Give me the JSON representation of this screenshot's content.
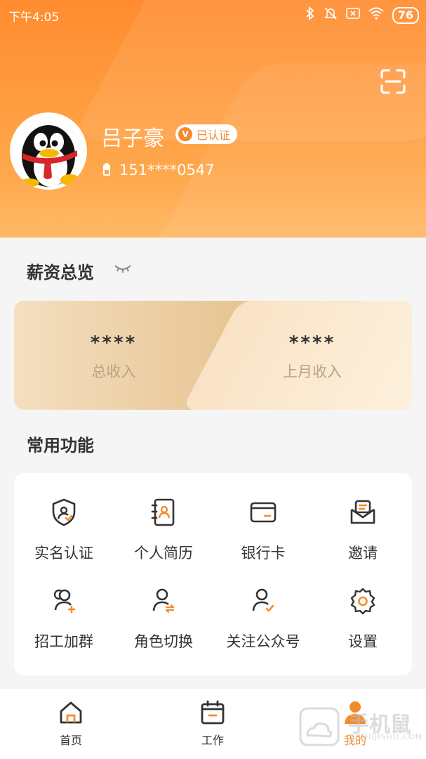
{
  "status_bar": {
    "time": "下午4:05",
    "battery": "76"
  },
  "profile": {
    "name": "吕子豪",
    "verified_label": "已认证",
    "phone": "151****0547"
  },
  "salary": {
    "title": "薪资总览",
    "items": [
      {
        "value": "****",
        "label": "总收入"
      },
      {
        "value": "****",
        "label": "上月收入"
      }
    ]
  },
  "functions": {
    "title": "常用功能",
    "items": [
      {
        "label": "实名认证",
        "icon": "shield-check-icon"
      },
      {
        "label": "个人简历",
        "icon": "resume-icon"
      },
      {
        "label": "银行卡",
        "icon": "bank-card-icon"
      },
      {
        "label": "邀请",
        "icon": "invite-mail-icon"
      },
      {
        "label": "招工加群",
        "icon": "user-add-icon"
      },
      {
        "label": "角色切换",
        "icon": "role-switch-icon"
      },
      {
        "label": "关注公众号",
        "icon": "follow-user-icon"
      },
      {
        "label": "设置",
        "icon": "gear-icon"
      }
    ]
  },
  "tabbar": {
    "items": [
      {
        "label": "首页",
        "icon": "home-icon"
      },
      {
        "label": "工作",
        "icon": "calendar-icon"
      },
      {
        "label": "我的",
        "icon": "profile-icon",
        "active": true
      }
    ]
  },
  "watermark": {
    "text": "手机鼠",
    "sub": "SHOUJISHU.COM"
  },
  "colors": {
    "accent": "#f58a2c",
    "header_start": "#ff8c2f",
    "header_end": "#ffb866"
  }
}
